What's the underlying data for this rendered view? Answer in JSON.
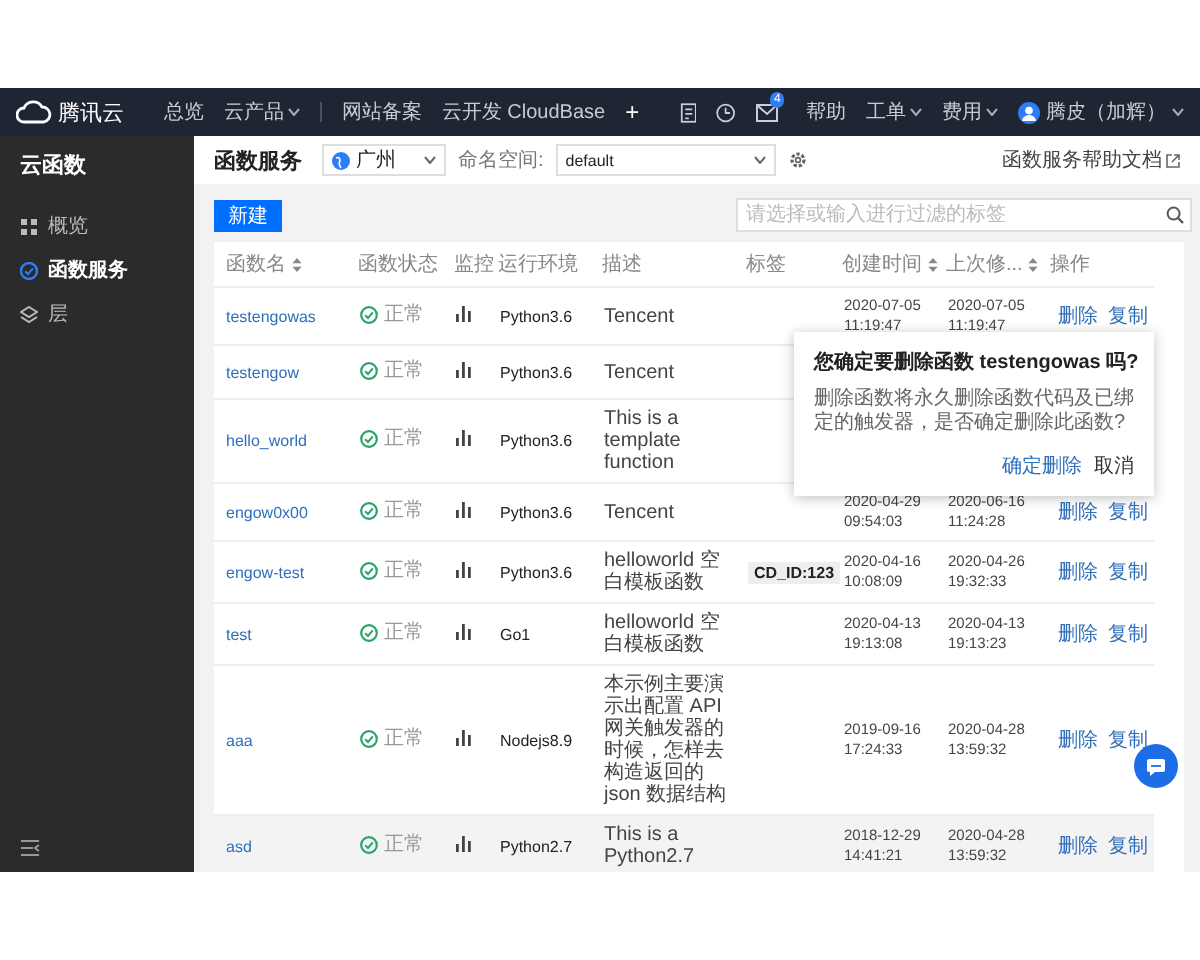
{
  "top_nav": {
    "logo": "腾讯云",
    "links": [
      {
        "label": "总览",
        "dropdown": false
      },
      {
        "label": "云产品",
        "dropdown": true
      },
      {
        "label": "网站备案",
        "dropdown": false
      },
      {
        "label": "云开发 CloudBase",
        "dropdown": false
      }
    ],
    "add": "+",
    "mail_badge": "4",
    "right_links": [
      {
        "label": "帮助",
        "dropdown": false
      },
      {
        "label": "工单",
        "dropdown": true
      },
      {
        "label": "费用",
        "dropdown": true
      }
    ],
    "user": "腾皮（加辉）"
  },
  "sidebar": {
    "title": "云函数",
    "items": [
      {
        "label": "概览",
        "kind": "overview",
        "selected": false
      },
      {
        "label": "函数服务",
        "kind": "functions",
        "selected": true
      },
      {
        "label": "层",
        "kind": "layers",
        "selected": false
      }
    ]
  },
  "page_header": {
    "title": "函数服务",
    "region": "广州",
    "namespace_label": "命名空间:",
    "namespace": "default",
    "help_link": "函数服务帮助文档"
  },
  "toolbar": {
    "create_button": "新建",
    "search_placeholder": "请选择或输入进行过滤的标签"
  },
  "table": {
    "columns": [
      {
        "label": "函数名",
        "sortable": true
      },
      {
        "label": "函数状态",
        "sortable": false
      },
      {
        "label": "监控",
        "sortable": false
      },
      {
        "label": "运行环境",
        "sortable": false
      },
      {
        "label": "描述",
        "sortable": false
      },
      {
        "label": "标签",
        "sortable": false
      },
      {
        "label": "创建时间",
        "sortable": true
      },
      {
        "label": "上次修...",
        "sortable": true
      },
      {
        "label": "操作",
        "sortable": false
      }
    ],
    "rows": [
      {
        "name": "testengowas",
        "status": "正常",
        "runtime": "Python3.6",
        "description": "Tencent",
        "created": "2020-07-05 11:19:47",
        "updated": "2020-07-05 11:19:47",
        "actions": [
          "删除",
          "复制"
        ],
        "highlighted": false
      },
      {
        "name": "testengow",
        "status": "正常",
        "runtime": "Python3.6",
        "description": "Tencent",
        "highlighted": false
      },
      {
        "name": "hello_world",
        "status": "正常",
        "runtime": "Python3.6",
        "description": "This is a template function",
        "highlighted": false
      },
      {
        "name": "engow0x00",
        "status": "正常",
        "runtime": "Python3.6",
        "description": "Tencent",
        "created": "2020-04-29 09:54:03",
        "updated": "2020-06-16 11:24:28",
        "actions": [
          "删除",
          "复制"
        ],
        "highlighted": false
      },
      {
        "name": "engow-test",
        "status": "正常",
        "runtime": "Python3.6",
        "description": "helloworld 空白模板函数",
        "tag": "CD_ID:123",
        "created": "2020-04-16 10:08:09",
        "updated": "2020-04-26 19:32:33",
        "actions": [
          "删除",
          "复制"
        ],
        "highlighted": false
      },
      {
        "name": "test",
        "status": "正常",
        "runtime": "Go1",
        "description": "helloworld 空白模板函数",
        "created": "2020-04-13 19:13:08",
        "updated": "2020-04-13 19:13:23",
        "actions": [
          "删除",
          "复制"
        ],
        "highlighted": false
      },
      {
        "name": "aaa",
        "status": "正常",
        "runtime": "Nodejs8.9",
        "description": "本示例主要演示出配置 API 网关触发器的时候，怎样去构造返回的 json 数据结构",
        "created": "2019-09-16 17:24:33",
        "updated": "2020-04-28 13:59:32",
        "actions": [
          "删除",
          "复制"
        ],
        "highlighted": false
      },
      {
        "name": "asd",
        "status": "正常",
        "runtime": "Python2.7",
        "description": "This is a Python2.7",
        "created": "2018-12-29 14:41:21",
        "updated": "2020-04-28 13:59:32",
        "actions": [
          "删除",
          "复制"
        ],
        "highlighted": true
      }
    ]
  },
  "popover": {
    "title": "您确定要删除函数 testengowas 吗?",
    "message": "删除函数将永久删除函数代码及已绑定的触发器，是否确定删除此函数?",
    "confirm": "确定删除",
    "cancel": "取消"
  }
}
